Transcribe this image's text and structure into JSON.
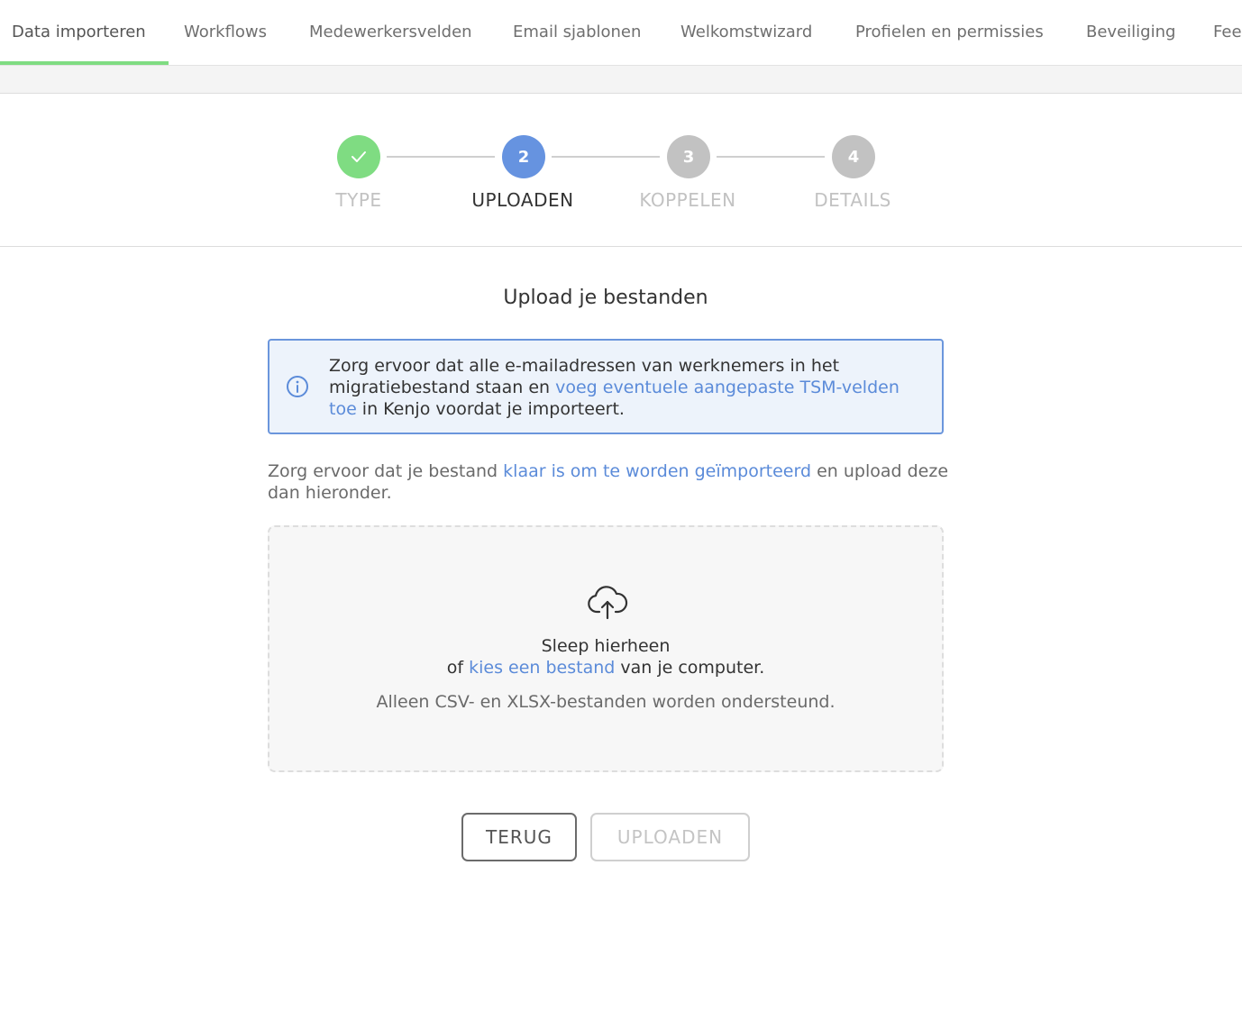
{
  "tabs": [
    {
      "label": "Data importeren",
      "active": true
    },
    {
      "label": "Workflows"
    },
    {
      "label": "Medewerkersvelden"
    },
    {
      "label": "Email sjablonen"
    },
    {
      "label": "Welkomstwizard"
    },
    {
      "label": "Profielen en permissies"
    },
    {
      "label": "Beveiliging"
    },
    {
      "label": "Fee"
    }
  ],
  "stepper": {
    "steps": [
      {
        "number": "",
        "label": "TYPE",
        "state": "done",
        "icon": "check-icon"
      },
      {
        "number": "2",
        "label": "UPLOADEN",
        "state": "current"
      },
      {
        "number": "3",
        "label": "KOPPELEN",
        "state": "todo"
      },
      {
        "number": "4",
        "label": "DETAILS",
        "state": "todo"
      }
    ]
  },
  "main": {
    "title": "Upload je bestanden",
    "info": {
      "icon": "info-icon",
      "text_before": "Zorg ervoor dat alle e-mailadressen van werknemers in het migratiebestand staan en ",
      "link": "voeg eventuele aangepaste TSM-velden toe",
      "text_after": " in Kenjo voordat je importeert."
    },
    "instruction": {
      "text_before": "Zorg ervoor dat je bestand ",
      "link": "klaar is om te worden geïmporteerd",
      "text_after": " en upload deze dan hieronder."
    },
    "dropzone": {
      "icon": "cloud-upload-icon",
      "line1": "Sleep hierheen",
      "line2_before": "of ",
      "line2_link": "kies een bestand",
      "line2_after": " van je computer.",
      "hint": "Alleen CSV- en XLSX-bestanden worden ondersteund."
    },
    "buttons": {
      "back": "TERUG",
      "upload": "UPLOADEN"
    }
  },
  "colors": {
    "accent_green": "#7fdc82",
    "accent_blue": "#6693e0",
    "link_blue": "#5b8bd9",
    "step_todo": "#c2c2c2"
  }
}
